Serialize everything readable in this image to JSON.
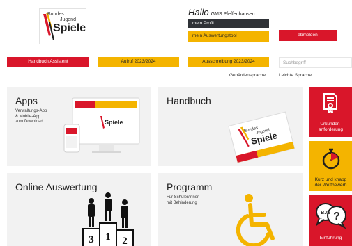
{
  "header": {
    "logo": {
      "line1": "Bundes",
      "line2": "Jugend",
      "line3": "Spiele"
    },
    "greeting": "Hallo",
    "school": "GMS Pfeffenhausen",
    "profile_button": "mein Profil",
    "evaluation_tool_button": "mein Auswertungstool",
    "logout_button": "abmelden"
  },
  "nav": {
    "items": [
      "Handbuch Assistent",
      "Aufruf 2023/2024",
      "Ausschreibung 2023/2024"
    ],
    "search_placeholder": "Suchbegriff",
    "sign_language": "Gebärdensprache",
    "easy_language": "Leichte Sprache"
  },
  "tiles": {
    "apps": {
      "title": "Apps",
      "subtitle": [
        "Verwaltungs-App",
        "& Mobile-App",
        "zum Download"
      ]
    },
    "handbuch": {
      "title": "Handbuch"
    },
    "online": {
      "title": "Online Auswertung",
      "podium": [
        "3",
        "1",
        "2"
      ]
    },
    "programm": {
      "title": "Programm",
      "subtitle": [
        "Für Schüler/innen",
        "mit Behinderung"
      ]
    }
  },
  "side": {
    "certificate": [
      "Urkunden-",
      "anforderung"
    ],
    "competitions": [
      "Kurz und knapp",
      "der Wettbewerb"
    ],
    "intro_badge": "BJS",
    "intro": "Einführung"
  },
  "colors": {
    "red": "#d9162a",
    "yellow": "#f4b400",
    "dark": "#2f3237",
    "tile": "#f2f2f2"
  }
}
